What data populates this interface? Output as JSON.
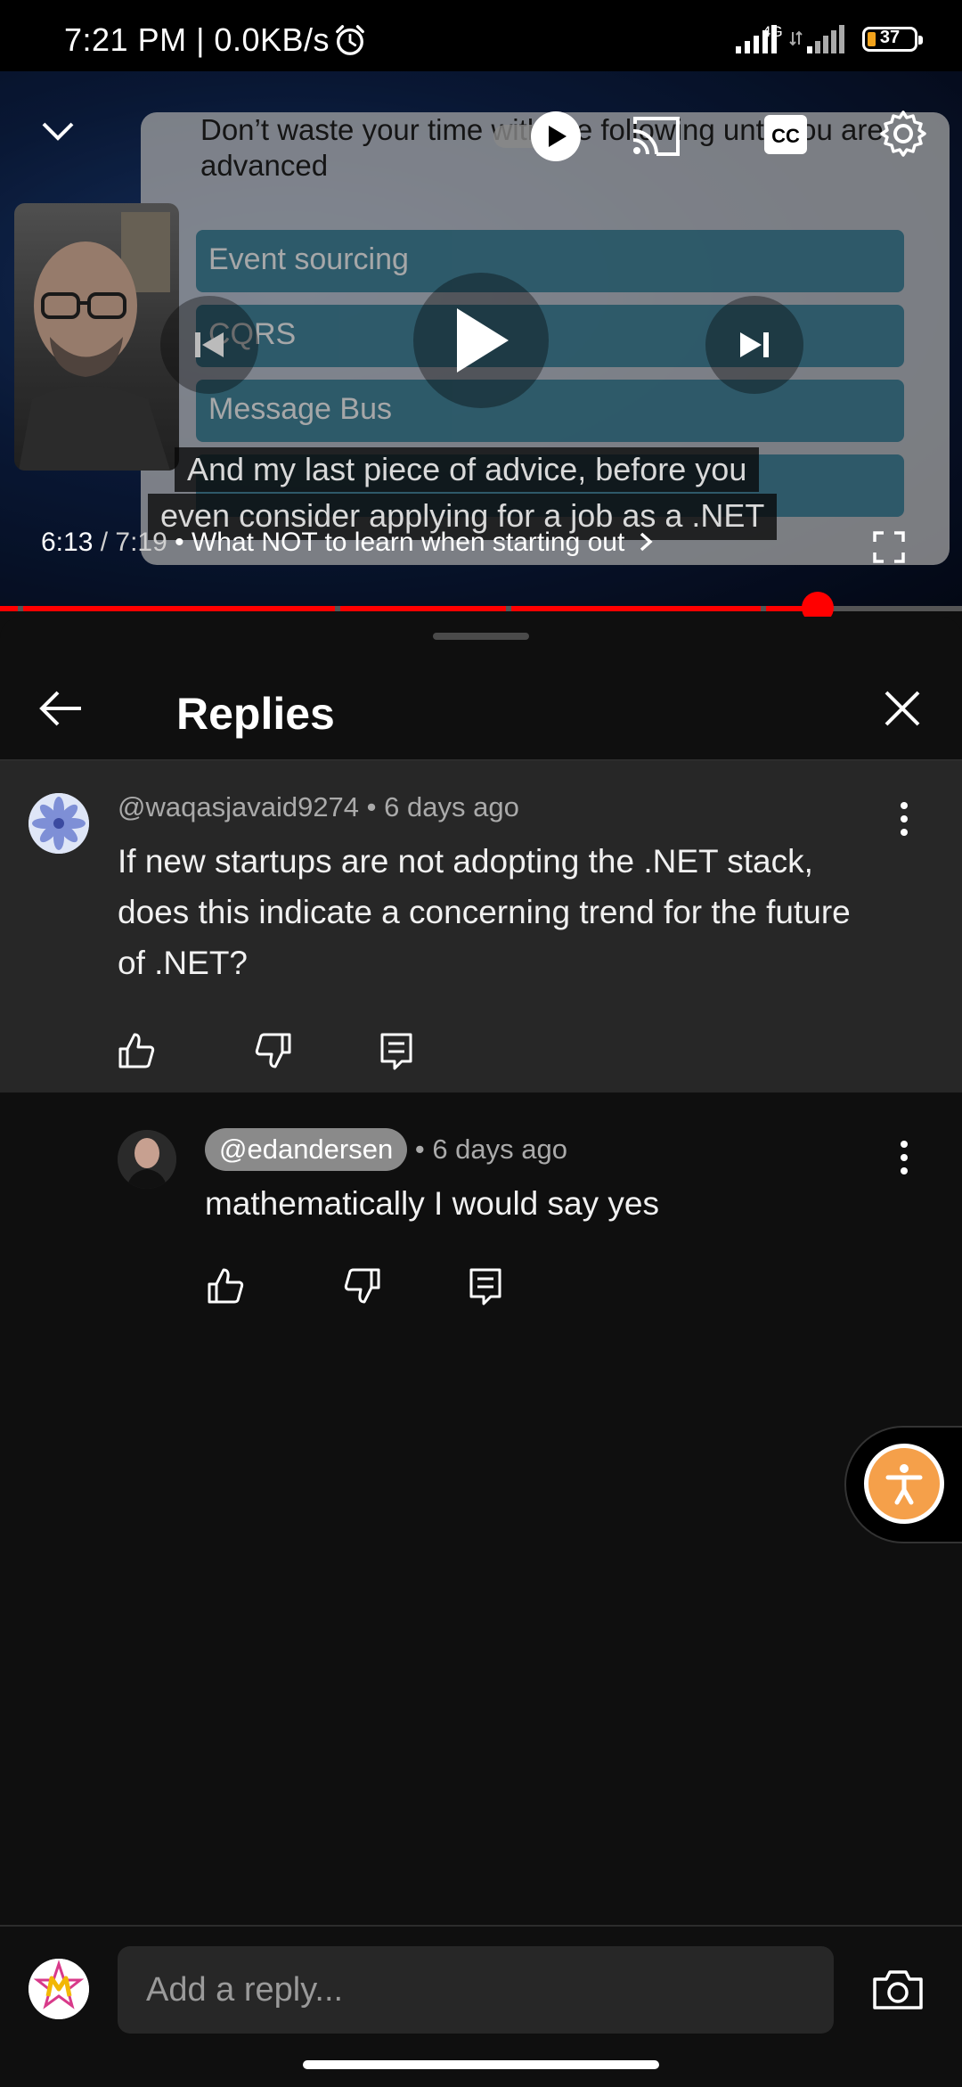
{
  "status_bar": {
    "time": "7:21 PM | 0.0KB/s",
    "network_type": "4G",
    "battery": "37"
  },
  "player": {
    "slide_heading": "Don’t waste your time with the following until you are advanced",
    "slide_items": [
      "Event sourcing",
      "CQRS",
      "Message Bus",
      ""
    ],
    "caption_lines": [
      "And my last piece of advice, before you",
      "even consider applying for a job as a .NET"
    ],
    "current_time": "6:13",
    "duration": "7:19",
    "chapter_title": "What NOT to learn when starting out",
    "progress_fraction": 0.85,
    "accent_color": "#ff0000"
  },
  "replies_panel": {
    "title": "Replies",
    "parent_comment": {
      "author": "@waqasjavaid9274",
      "age": "6 days ago",
      "text": "If new startups are not adopting the .NET stack, does this indicate a concerning trend for the future of .NET?"
    },
    "reply": {
      "author": "@edandersen",
      "age": "6 days ago",
      "text": "mathematically I would say yes"
    },
    "input_placeholder": "Add a reply..."
  }
}
